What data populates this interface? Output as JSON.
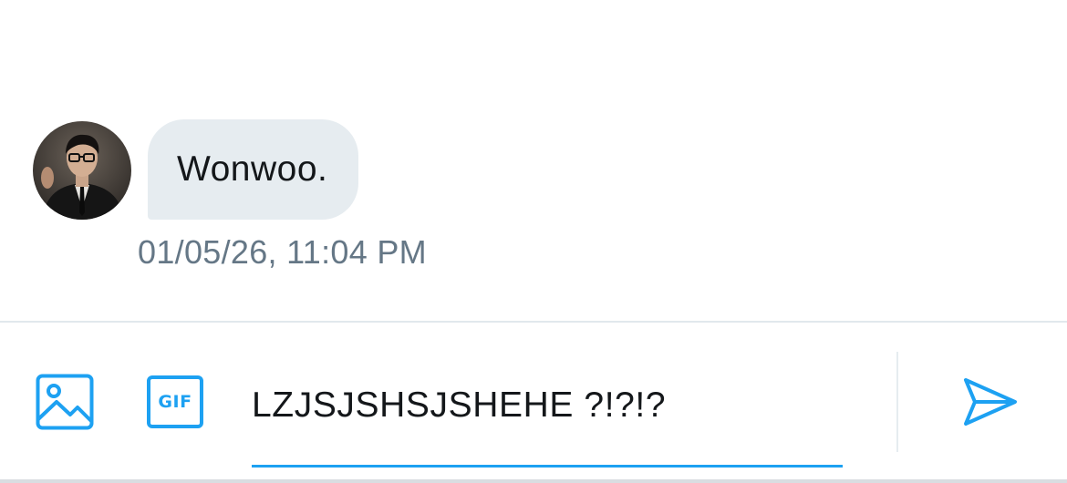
{
  "conversation": {
    "messages": [
      {
        "sender": "other",
        "text": "Wonwoo.",
        "timestamp": "01/05/26, 11:04 PM",
        "avatar_icon": "user-photo-avatar"
      }
    ]
  },
  "composer": {
    "input_value": "LZJSJSHSJSHEHE ?!?!?",
    "media_icon": "image-icon",
    "gif_label": "GIF",
    "send_icon": "send-icon"
  },
  "colors": {
    "accent": "#1da1f2",
    "bubble_bg": "#e6ecf0",
    "text": "#14171a",
    "timestamp": "#657786",
    "divider": "#e1e8ed"
  }
}
